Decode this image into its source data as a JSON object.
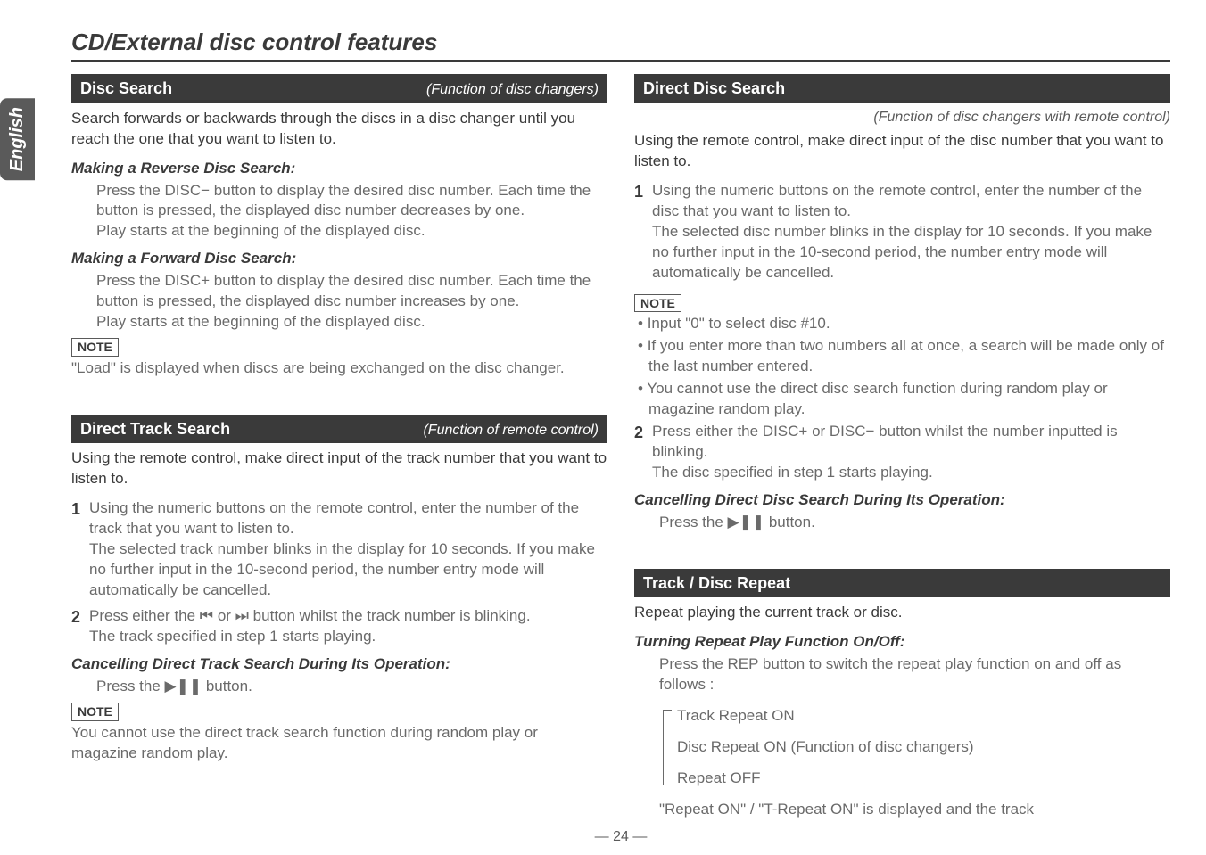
{
  "lang_tab": "English",
  "section_title": "CD/External disc control features",
  "page_number": "— 24 —",
  "left": {
    "disc_search": {
      "title": "Disc Search",
      "func": "(Function of disc changers)",
      "lead": "Search forwards or backwards through the discs in a disc changer until you reach the one that you want to listen to.",
      "reverse_head": "Making a Reverse Disc Search:",
      "reverse_body1": "Press the DISC− button to display the desired disc number. Each time the button is pressed, the displayed disc number decreases by one.",
      "reverse_body2": "Play starts at the beginning of the displayed disc.",
      "forward_head": "Making a Forward Disc Search:",
      "forward_body1": "Press the DISC+ button to display the desired disc number. Each time the button is pressed, the displayed disc number increases by one.",
      "forward_body2": "Play starts at the beginning of the displayed disc.",
      "note_label": "NOTE",
      "note_body": "\"Load\" is displayed when discs are being exchanged on the disc changer."
    },
    "direct_track": {
      "title": "Direct Track Search",
      "func": "(Function of remote control)",
      "lead": "Using the remote control, make direct input of the track number that you want to listen to.",
      "step1": "Using the numeric buttons on the remote control, enter the number of the track that you want to listen to.\nThe selected track number blinks in the display for 10 seconds. If you make no further input in the 10-second period, the number entry mode will automatically be cancelled.",
      "step2": "Press either the ⏮ or ⏭ button whilst the track number is blinking.\nThe track specified in step 1 starts playing.",
      "cancel_head": "Cancelling Direct Track Search During Its Operation:",
      "cancel_body": "Press the ▶❚❚ button.",
      "note_label": "NOTE",
      "note_body": "You cannot use the direct track search function during random play or magazine random play."
    }
  },
  "right": {
    "direct_disc": {
      "title": "Direct Disc Search",
      "func": "(Function of disc changers with remote control)",
      "lead": "Using the remote control, make direct input of the disc number that you want to listen to.",
      "step1": "Using the numeric buttons on the remote control, enter the number of the disc that you want to listen to.\nThe selected disc number blinks in the display for 10 seconds. If you make no further input in the 10-second period, the number entry mode will automatically be cancelled.",
      "note_label": "NOTE",
      "bullets": [
        "Input \"0\" to select disc #10.",
        "If you enter more than two numbers all at once, a search will be made only of the last number entered.",
        "You cannot use the direct disc search function during random play or magazine random play."
      ],
      "step2": "Press either the DISC+ or DISC− button whilst the number inputted is blinking.\nThe disc specified in step 1 starts playing.",
      "cancel_head": "Cancelling Direct Disc Search During Its Operation:",
      "cancel_body": "Press the ▶❚❚ button."
    },
    "repeat": {
      "title": "Track / Disc Repeat",
      "lead": "Repeat playing the current track or disc.",
      "turn_head": "Turning Repeat Play Function On/Off:",
      "turn_body": "Press the REP button to switch the repeat play function on and off as follows :",
      "item1": "Track Repeat ON",
      "item2": "Disc Repeat ON (Function of disc changers)",
      "item3": "Repeat OFF",
      "tail": "\"Repeat ON\" /  \"T-Repeat ON\" is displayed and the track"
    }
  }
}
